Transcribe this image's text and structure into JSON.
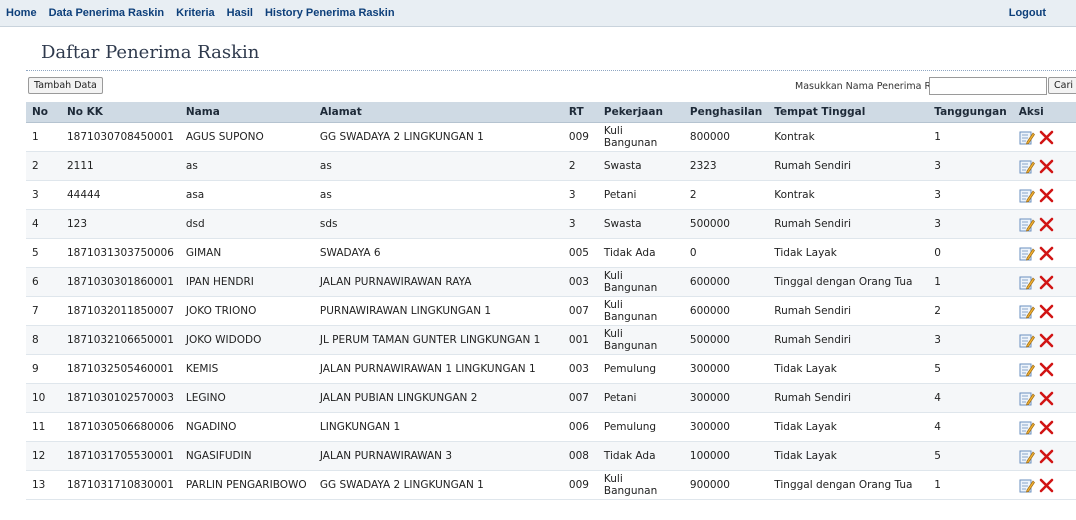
{
  "nav": {
    "items": [
      {
        "label": "Home"
      },
      {
        "label": "Data Penerima Raskin"
      },
      {
        "label": "Kriteria"
      },
      {
        "label": "Hasil"
      },
      {
        "label": "History Penerima Raskin"
      }
    ],
    "logout": "Logout"
  },
  "page": {
    "title": "Daftar Penerima Raskin"
  },
  "toolbar": {
    "add_label": "Tambah Data",
    "search_label": "Masukkan Nama Penerima Raskin :",
    "search_value": "",
    "find_label": "Cari"
  },
  "table": {
    "headers": [
      "No",
      "No KK",
      "Nama",
      "Alamat",
      "RT",
      "Pekerjaan",
      "Penghasilan",
      "Tempat Tinggal",
      "Tanggungan",
      "Aksi"
    ],
    "rows": [
      [
        "1",
        "1871030708450001",
        "AGUS SUPONO",
        "GG SWADAYA 2 LINGKUNGAN 1",
        "009",
        "Kuli Bangunan",
        "800000",
        "Kontrak",
        "1"
      ],
      [
        "2",
        "2111",
        "as",
        "as",
        "2",
        "Swasta",
        "2323",
        "Rumah Sendiri",
        "3"
      ],
      [
        "3",
        "44444",
        "asa",
        "as",
        "3",
        "Petani",
        "2",
        "Kontrak",
        "3"
      ],
      [
        "4",
        "123",
        "dsd",
        "sds",
        "3",
        "Swasta",
        "500000",
        "Rumah Sendiri",
        "3"
      ],
      [
        "5",
        "1871031303750006",
        "GIMAN",
        "SWADAYA 6",
        "005",
        "Tidak Ada",
        "0",
        "Tidak Layak",
        "0"
      ],
      [
        "6",
        "1871030301860001",
        "IPAN HENDRI",
        "JALAN PURNAWIRAWAN RAYA",
        "003",
        "Kuli Bangunan",
        "600000",
        "Tinggal dengan Orang Tua",
        "1"
      ],
      [
        "7",
        "1871032011850007",
        "JOKO TRIONO",
        "PURNAWIRAWAN LINGKUNGAN 1",
        "007",
        "Kuli Bangunan",
        "600000",
        "Rumah Sendiri",
        "2"
      ],
      [
        "8",
        "1871032106650001",
        "JOKO WIDODO",
        "JL PERUM TAMAN GUNTER LINGKUNGAN 1",
        "001",
        "Kuli Bangunan",
        "500000",
        "Rumah Sendiri",
        "3"
      ],
      [
        "9",
        "1871032505460001",
        "KEMIS",
        "JALAN PURNAWIRAWAN 1 LINGKUNGAN 1",
        "003",
        "Pemulung",
        "300000",
        "Tidak Layak",
        "5"
      ],
      [
        "10",
        "1871030102570003",
        "LEGINO",
        "JALAN PUBIAN LINGKUNGAN 2",
        "007",
        "Petani",
        "300000",
        "Rumah Sendiri",
        "4"
      ],
      [
        "11",
        "1871030506680006",
        "NGADINO",
        "LINGKUNGAN 1",
        "006",
        "Pemulung",
        "300000",
        "Tidak Layak",
        "4"
      ],
      [
        "12",
        "1871031705530001",
        "NGASIFUDIN",
        "JALAN PURNAWIRAWAN 3",
        "008",
        "Tidak Ada",
        "100000",
        "Tidak Layak",
        "5"
      ],
      [
        "13",
        "1871031710830001",
        "PARLIN PENGARIBOWO",
        "GG SWADAYA 2 LINGKUNGAN 1",
        "009",
        "Kuli Bangunan",
        "900000",
        "Tinggal dengan Orang Tua",
        "1"
      ]
    ],
    "action_icons": [
      "edit-icon",
      "delete-icon"
    ]
  },
  "colors": {
    "nav_text": "#0d3f7a",
    "header_bg": "#cfdae4",
    "delete": "#d11414"
  }
}
